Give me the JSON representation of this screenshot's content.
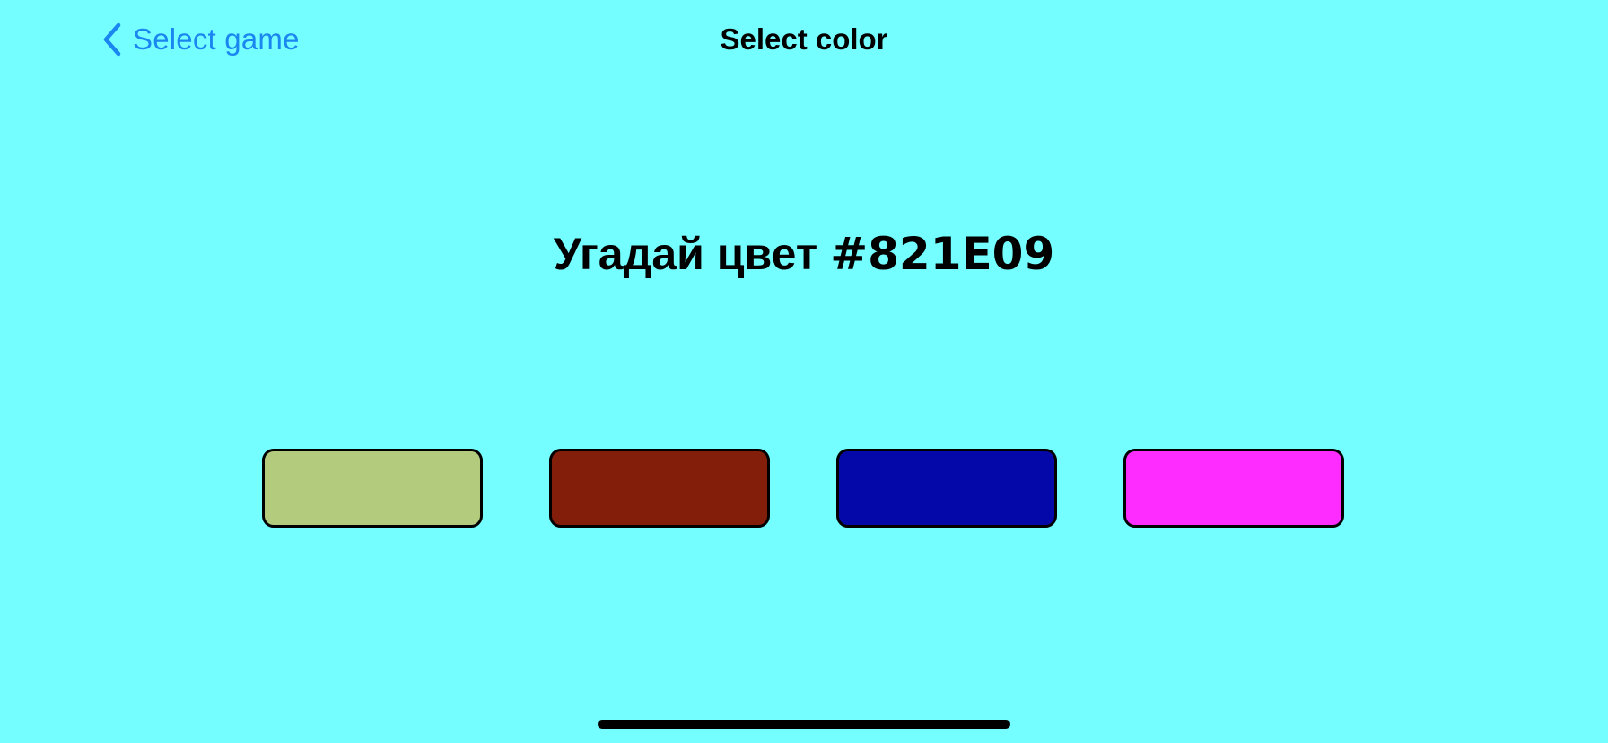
{
  "nav": {
    "back_label": "Select game",
    "back_icon": "chevron-left-icon",
    "title": "Select color",
    "accent_color": "#1A86F0"
  },
  "prompt": {
    "text": "Угадай цвет",
    "target_hex": "#821E09"
  },
  "background_color": "#75FEFF",
  "swatches": [
    {
      "color": "#B2CB7D"
    },
    {
      "color": "#821E09"
    },
    {
      "color": "#0408A8"
    },
    {
      "color": "#FF2CFF"
    }
  ]
}
